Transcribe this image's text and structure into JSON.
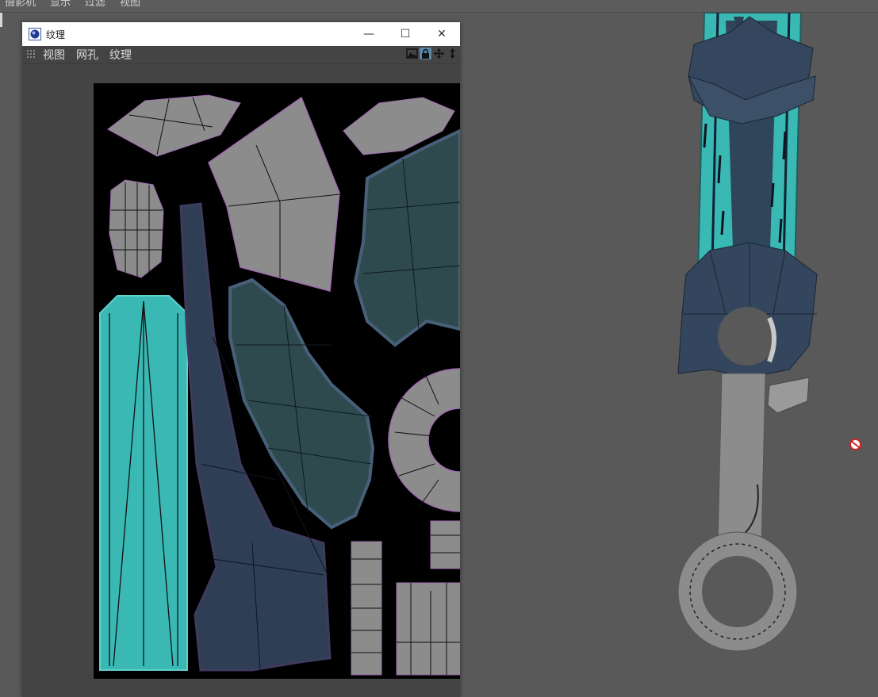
{
  "main_menu": [
    "摄影机",
    "显示",
    "过滤",
    "视图"
  ],
  "texture_window": {
    "title": "纹理",
    "menu": [
      "视图",
      "网孔",
      "纹理"
    ],
    "controls": {
      "minimize": "—",
      "maximize": "☐",
      "close": "✕"
    }
  },
  "icons": {
    "app": "app-logo-icon",
    "grip": "grip-icon",
    "tools": [
      "uv-image-icon",
      "lock-icon",
      "move-icon",
      "scale-icon"
    ],
    "status": "no-entry-icon"
  },
  "colors": {
    "cyan": "#3ab8b4",
    "navy": "#2e3f55",
    "teal_dark": "#2f4a4e",
    "grey": "#8c8c8c",
    "background": "#595959",
    "uv_bg": "#000000"
  }
}
